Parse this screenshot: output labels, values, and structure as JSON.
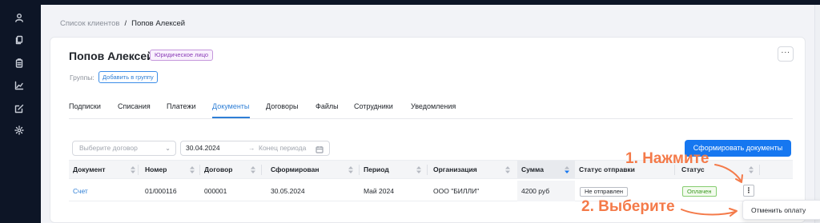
{
  "breadcrumb": {
    "parent": "Список клиентов",
    "separator": "/",
    "current": "Попов Алексей"
  },
  "client": {
    "name": "Попов Алексей",
    "type_badge": "Юридическое лицо"
  },
  "groups": {
    "label": "Группы:",
    "add_button": "Добавить в группу"
  },
  "more_button": "···",
  "tabs": [
    {
      "label": "Подписки",
      "active": false
    },
    {
      "label": "Списания",
      "active": false
    },
    {
      "label": "Платежи",
      "active": false
    },
    {
      "label": "Документы",
      "active": true
    },
    {
      "label": "Договоры",
      "active": false
    },
    {
      "label": "Файлы",
      "active": false
    },
    {
      "label": "Сотрудники",
      "active": false
    },
    {
      "label": "Уведомления",
      "active": false
    }
  ],
  "filters": {
    "contract_placeholder": "Выберите договор",
    "date_start": "30.04.2024",
    "date_arrow": "→",
    "date_end_placeholder": "Конец периода"
  },
  "generate_button": "Сформировать документы",
  "table": {
    "columns": [
      "Документ",
      "Номер",
      "Договор",
      "Сформирован",
      "Период",
      "Организация",
      "Сумма",
      "Статус отправки",
      "Статус"
    ],
    "sorted_column": "Сумма",
    "rows": [
      {
        "document": "Счет",
        "number": "01/000116",
        "contract": "000001",
        "created": "30.05.2024",
        "period": "Май 2024",
        "organization": "ООО \"БИЛЛИ\"",
        "amount": "4200 руб",
        "send_status": "Не отправлен",
        "status": "Оплачен",
        "actions": "⋮"
      }
    ]
  },
  "dropdown": {
    "items": [
      "Отменить оплату"
    ]
  },
  "annotations": {
    "step1": "1. Нажмите",
    "step2": "2. Выберите"
  },
  "colors": {
    "accent": "#1677f0",
    "sidebar": "#0d1526",
    "annotation": "#f47a49",
    "paid": "#3c9a22",
    "badge": "#8b3db8"
  },
  "sidebar_icons": [
    "user-icon",
    "document-copy-icon",
    "clipboard-icon",
    "chart-icon",
    "edit-icon",
    "settings-icon"
  ]
}
